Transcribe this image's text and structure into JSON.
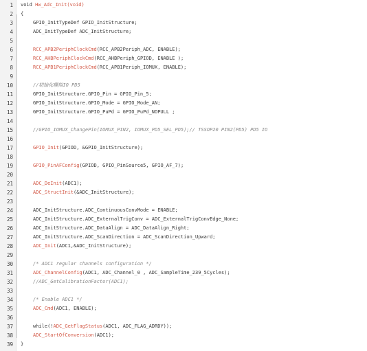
{
  "editor": {
    "lines": [
      {
        "n": "1",
        "indent": 0,
        "parts": [
          {
            "t": "void ",
            "c": "kw"
          },
          {
            "t": "Hw_Adc_Init(void)",
            "c": "fn"
          }
        ]
      },
      {
        "n": "2",
        "indent": 0,
        "parts": [
          {
            "t": "{",
            "c": "plain"
          }
        ]
      },
      {
        "n": "3",
        "indent": 1,
        "parts": [
          {
            "t": "GPIO_InitTypeDef GPIO_InitStructure;",
            "c": "plain"
          }
        ]
      },
      {
        "n": "4",
        "indent": 1,
        "parts": [
          {
            "t": "ADC_InitTypeDef ADC_InitStructure;",
            "c": "plain"
          }
        ]
      },
      {
        "n": "5",
        "indent": 0,
        "parts": []
      },
      {
        "n": "6",
        "indent": 1,
        "parts": [
          {
            "t": "RCC_APB2PeriphClockCmd",
            "c": "fn"
          },
          {
            "t": "(RCC_APB2Periph_ADC, ENABLE);",
            "c": "plain"
          }
        ]
      },
      {
        "n": "7",
        "indent": 1,
        "parts": [
          {
            "t": "RCC_AHBPeriphClockCmd",
            "c": "fn"
          },
          {
            "t": "(RCC_AHBPeriph_GPIOD, ENABLE );",
            "c": "plain"
          }
        ]
      },
      {
        "n": "8",
        "indent": 1,
        "parts": [
          {
            "t": "RCC_APB1PeriphClockCmd",
            "c": "fn"
          },
          {
            "t": "(RCC_APB1Periph_IOMUX, ENABLE);",
            "c": "plain"
          }
        ]
      },
      {
        "n": "9",
        "indent": 0,
        "parts": []
      },
      {
        "n": "10",
        "indent": 1,
        "parts": [
          {
            "t": "//初始化模拟IO PD5",
            "c": "cm"
          }
        ]
      },
      {
        "n": "11",
        "indent": 1,
        "parts": [
          {
            "t": "GPIO_InitStructure.GPIO_Pin = GPIO_Pin_5;",
            "c": "plain"
          }
        ]
      },
      {
        "n": "12",
        "indent": 1,
        "parts": [
          {
            "t": "GPIO_InitStructure.GPIO_Mode = GPIO_Mode_AN;",
            "c": "plain"
          }
        ]
      },
      {
        "n": "13",
        "indent": 1,
        "parts": [
          {
            "t": "GPIO_InitStructure.GPIO_PuPd = GPIO_PuPd_NOPULL ;",
            "c": "plain"
          }
        ]
      },
      {
        "n": "14",
        "indent": 0,
        "parts": []
      },
      {
        "n": "15",
        "indent": 1,
        "parts": [
          {
            "t": "//GPIO_IOMUX_ChangePin(IOMUX_PIN2, IOMUX_PD5_SEL_PD5);// TSSOP20 PIN2(PD5) PD5 IO",
            "c": "cm"
          }
        ]
      },
      {
        "n": "16",
        "indent": 0,
        "parts": []
      },
      {
        "n": "17",
        "indent": 1,
        "parts": [
          {
            "t": "GPIO_Init",
            "c": "fn"
          },
          {
            "t": "(GPIOD, &GPIO_InitStructure);",
            "c": "plain"
          }
        ]
      },
      {
        "n": "18",
        "indent": 0,
        "parts": []
      },
      {
        "n": "19",
        "indent": 1,
        "parts": [
          {
            "t": "GPIO_PinAFConfig",
            "c": "fn"
          },
          {
            "t": "(GPIOD, GPIO_PinSource5, GPIO_AF_7);",
            "c": "plain"
          }
        ]
      },
      {
        "n": "20",
        "indent": 0,
        "parts": []
      },
      {
        "n": "21",
        "indent": 1,
        "parts": [
          {
            "t": "ADC_DeInit",
            "c": "fn"
          },
          {
            "t": "(ADC1);",
            "c": "plain"
          }
        ]
      },
      {
        "n": "22",
        "indent": 1,
        "parts": [
          {
            "t": "ADC_StructInit",
            "c": "fn"
          },
          {
            "t": "(&ADC_InitStructure);",
            "c": "plain"
          }
        ]
      },
      {
        "n": "23",
        "indent": 0,
        "parts": []
      },
      {
        "n": "24",
        "indent": 1,
        "parts": [
          {
            "t": "ADC_InitStructure.ADC_ContinuousConvMode = ENABLE;",
            "c": "plain"
          }
        ]
      },
      {
        "n": "25",
        "indent": 1,
        "parts": [
          {
            "t": "ADC_InitStructure.ADC_ExternalTrigConv = ADC_ExternalTrigConvEdge_None;",
            "c": "plain"
          }
        ]
      },
      {
        "n": "26",
        "indent": 1,
        "parts": [
          {
            "t": "ADC_InitStructure.ADC_DataAlign = ADC_DataAlign_Right;",
            "c": "plain"
          }
        ]
      },
      {
        "n": "27",
        "indent": 1,
        "parts": [
          {
            "t": "ADC_InitStructure.ADC_ScanDirection = ADC_ScanDirection_Upward;",
            "c": "plain"
          }
        ]
      },
      {
        "n": "28",
        "indent": 1,
        "parts": [
          {
            "t": "ADC_Init",
            "c": "fn"
          },
          {
            "t": "(ADC1,&ADC_InitStructure);",
            "c": "plain"
          }
        ]
      },
      {
        "n": "29",
        "indent": 0,
        "parts": []
      },
      {
        "n": "30",
        "indent": 1,
        "parts": [
          {
            "t": "/* ADC1 regular channels configuration */",
            "c": "cm"
          }
        ]
      },
      {
        "n": "31",
        "indent": 1,
        "parts": [
          {
            "t": "ADC_ChannelConfig",
            "c": "fn"
          },
          {
            "t": "(ADC1, ADC_Channel_0 , ADC_SampleTime_239_5Cycles);",
            "c": "plain"
          }
        ]
      },
      {
        "n": "32",
        "indent": 1,
        "parts": [
          {
            "t": "//ADC_GetCalibrationFactor(ADC1);",
            "c": "cm"
          }
        ]
      },
      {
        "n": "33",
        "indent": 0,
        "parts": []
      },
      {
        "n": "34",
        "indent": 1,
        "parts": [
          {
            "t": "/* Enable ADC1 */",
            "c": "cm"
          }
        ]
      },
      {
        "n": "35",
        "indent": 1,
        "parts": [
          {
            "t": "ADC_Cmd",
            "c": "fn"
          },
          {
            "t": "(ADC1, ENABLE);",
            "c": "plain"
          }
        ]
      },
      {
        "n": "36",
        "indent": 0,
        "parts": []
      },
      {
        "n": "37",
        "indent": 1,
        "parts": [
          {
            "t": "while(!",
            "c": "plain"
          },
          {
            "t": "ADC_GetFlagStatus",
            "c": "fn"
          },
          {
            "t": "(ADC1, ADC_FLAG_ADRDY));",
            "c": "plain"
          }
        ]
      },
      {
        "n": "38",
        "indent": 1,
        "parts": [
          {
            "t": "ADC_StartOfConversion",
            "c": "fn"
          },
          {
            "t": "(ADC1);",
            "c": "plain"
          }
        ]
      },
      {
        "n": "39",
        "indent": 0,
        "parts": [
          {
            "t": "}",
            "c": "plain"
          }
        ]
      }
    ]
  }
}
